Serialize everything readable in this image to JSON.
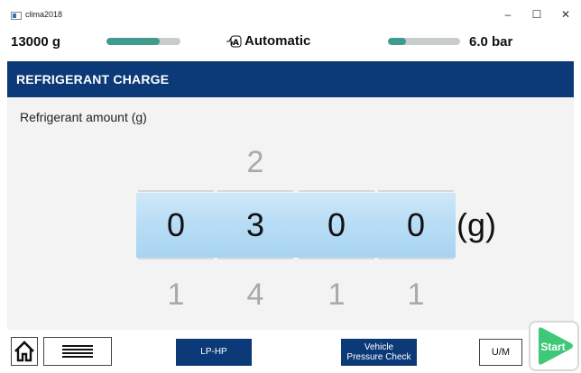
{
  "window": {
    "title": "clima2018",
    "minimize_glyph": "–",
    "maximize_glyph": "☐",
    "close_glyph": "✕"
  },
  "status": {
    "weight": "13000 g",
    "weight_level": 0.72,
    "mode": "Automatic",
    "mode_icon": "A",
    "pressure_level": 0.25,
    "pressure": "6.0 bar",
    "gauge_color": "#3f9b8e"
  },
  "section": {
    "title": "REFRIGERANT CHARGE",
    "color": "#0c3978"
  },
  "field": {
    "label": "Refrigerant amount (g)",
    "unit": "(g)",
    "digits_above": [
      "",
      "2",
      "",
      ""
    ],
    "digits": [
      "0",
      "3",
      "0",
      "0"
    ],
    "digits_below": [
      "1",
      "4",
      "1",
      "1"
    ]
  },
  "bottom": {
    "lp_hp": "LP-HP",
    "vehicle_pressure_line1": "Vehicle",
    "vehicle_pressure_line2": "Pressure Check",
    "um": "U/M",
    "start": "Start",
    "start_color": "#3ec878",
    "icons": {
      "home": "home-icon",
      "menu": "hamburger-menu-icon",
      "start": "play-start-icon"
    }
  }
}
